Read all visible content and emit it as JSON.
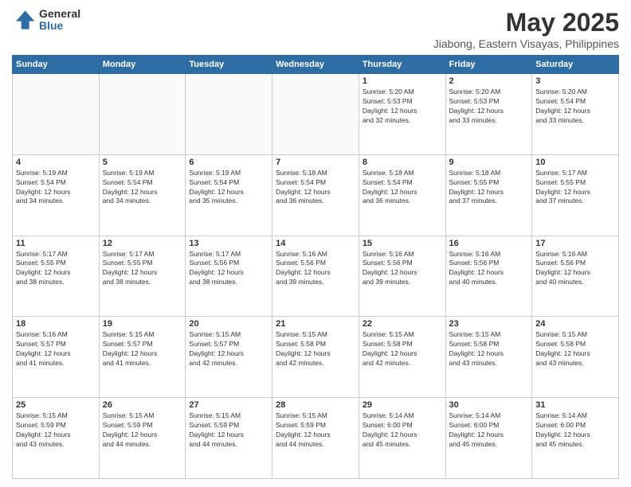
{
  "header": {
    "logo_general": "General",
    "logo_blue": "Blue",
    "title": "May 2025",
    "subtitle": "Jiabong, Eastern Visayas, Philippines"
  },
  "weekdays": [
    "Sunday",
    "Monday",
    "Tuesday",
    "Wednesday",
    "Thursday",
    "Friday",
    "Saturday"
  ],
  "weeks": [
    [
      {
        "day": "",
        "info": ""
      },
      {
        "day": "",
        "info": ""
      },
      {
        "day": "",
        "info": ""
      },
      {
        "day": "",
        "info": ""
      },
      {
        "day": "1",
        "info": "Sunrise: 5:20 AM\nSunset: 5:53 PM\nDaylight: 12 hours\nand 32 minutes."
      },
      {
        "day": "2",
        "info": "Sunrise: 5:20 AM\nSunset: 5:53 PM\nDaylight: 12 hours\nand 33 minutes."
      },
      {
        "day": "3",
        "info": "Sunrise: 5:20 AM\nSunset: 5:54 PM\nDaylight: 12 hours\nand 33 minutes."
      }
    ],
    [
      {
        "day": "4",
        "info": "Sunrise: 5:19 AM\nSunset: 5:54 PM\nDaylight: 12 hours\nand 34 minutes."
      },
      {
        "day": "5",
        "info": "Sunrise: 5:19 AM\nSunset: 5:54 PM\nDaylight: 12 hours\nand 34 minutes."
      },
      {
        "day": "6",
        "info": "Sunrise: 5:19 AM\nSunset: 5:54 PM\nDaylight: 12 hours\nand 35 minutes."
      },
      {
        "day": "7",
        "info": "Sunrise: 5:18 AM\nSunset: 5:54 PM\nDaylight: 12 hours\nand 36 minutes."
      },
      {
        "day": "8",
        "info": "Sunrise: 5:18 AM\nSunset: 5:54 PM\nDaylight: 12 hours\nand 36 minutes."
      },
      {
        "day": "9",
        "info": "Sunrise: 5:18 AM\nSunset: 5:55 PM\nDaylight: 12 hours\nand 37 minutes."
      },
      {
        "day": "10",
        "info": "Sunrise: 5:17 AM\nSunset: 5:55 PM\nDaylight: 12 hours\nand 37 minutes."
      }
    ],
    [
      {
        "day": "11",
        "info": "Sunrise: 5:17 AM\nSunset: 5:55 PM\nDaylight: 12 hours\nand 38 minutes."
      },
      {
        "day": "12",
        "info": "Sunrise: 5:17 AM\nSunset: 5:55 PM\nDaylight: 12 hours\nand 38 minutes."
      },
      {
        "day": "13",
        "info": "Sunrise: 5:17 AM\nSunset: 5:56 PM\nDaylight: 12 hours\nand 38 minutes."
      },
      {
        "day": "14",
        "info": "Sunrise: 5:16 AM\nSunset: 5:56 PM\nDaylight: 12 hours\nand 39 minutes."
      },
      {
        "day": "15",
        "info": "Sunrise: 5:16 AM\nSunset: 5:56 PM\nDaylight: 12 hours\nand 39 minutes."
      },
      {
        "day": "16",
        "info": "Sunrise: 5:16 AM\nSunset: 5:56 PM\nDaylight: 12 hours\nand 40 minutes."
      },
      {
        "day": "17",
        "info": "Sunrise: 5:16 AM\nSunset: 5:56 PM\nDaylight: 12 hours\nand 40 minutes."
      }
    ],
    [
      {
        "day": "18",
        "info": "Sunrise: 5:16 AM\nSunset: 5:57 PM\nDaylight: 12 hours\nand 41 minutes."
      },
      {
        "day": "19",
        "info": "Sunrise: 5:15 AM\nSunset: 5:57 PM\nDaylight: 12 hours\nand 41 minutes."
      },
      {
        "day": "20",
        "info": "Sunrise: 5:15 AM\nSunset: 5:57 PM\nDaylight: 12 hours\nand 42 minutes."
      },
      {
        "day": "21",
        "info": "Sunrise: 5:15 AM\nSunset: 5:58 PM\nDaylight: 12 hours\nand 42 minutes."
      },
      {
        "day": "22",
        "info": "Sunrise: 5:15 AM\nSunset: 5:58 PM\nDaylight: 12 hours\nand 42 minutes."
      },
      {
        "day": "23",
        "info": "Sunrise: 5:15 AM\nSunset: 5:58 PM\nDaylight: 12 hours\nand 43 minutes."
      },
      {
        "day": "24",
        "info": "Sunrise: 5:15 AM\nSunset: 5:58 PM\nDaylight: 12 hours\nand 43 minutes."
      }
    ],
    [
      {
        "day": "25",
        "info": "Sunrise: 5:15 AM\nSunset: 5:59 PM\nDaylight: 12 hours\nand 43 minutes."
      },
      {
        "day": "26",
        "info": "Sunrise: 5:15 AM\nSunset: 5:59 PM\nDaylight: 12 hours\nand 44 minutes."
      },
      {
        "day": "27",
        "info": "Sunrise: 5:15 AM\nSunset: 5:59 PM\nDaylight: 12 hours\nand 44 minutes."
      },
      {
        "day": "28",
        "info": "Sunrise: 5:15 AM\nSunset: 5:59 PM\nDaylight: 12 hours\nand 44 minutes."
      },
      {
        "day": "29",
        "info": "Sunrise: 5:14 AM\nSunset: 6:00 PM\nDaylight: 12 hours\nand 45 minutes."
      },
      {
        "day": "30",
        "info": "Sunrise: 5:14 AM\nSunset: 6:00 PM\nDaylight: 12 hours\nand 45 minutes."
      },
      {
        "day": "31",
        "info": "Sunrise: 5:14 AM\nSunset: 6:00 PM\nDaylight: 12 hours\nand 45 minutes."
      }
    ]
  ]
}
